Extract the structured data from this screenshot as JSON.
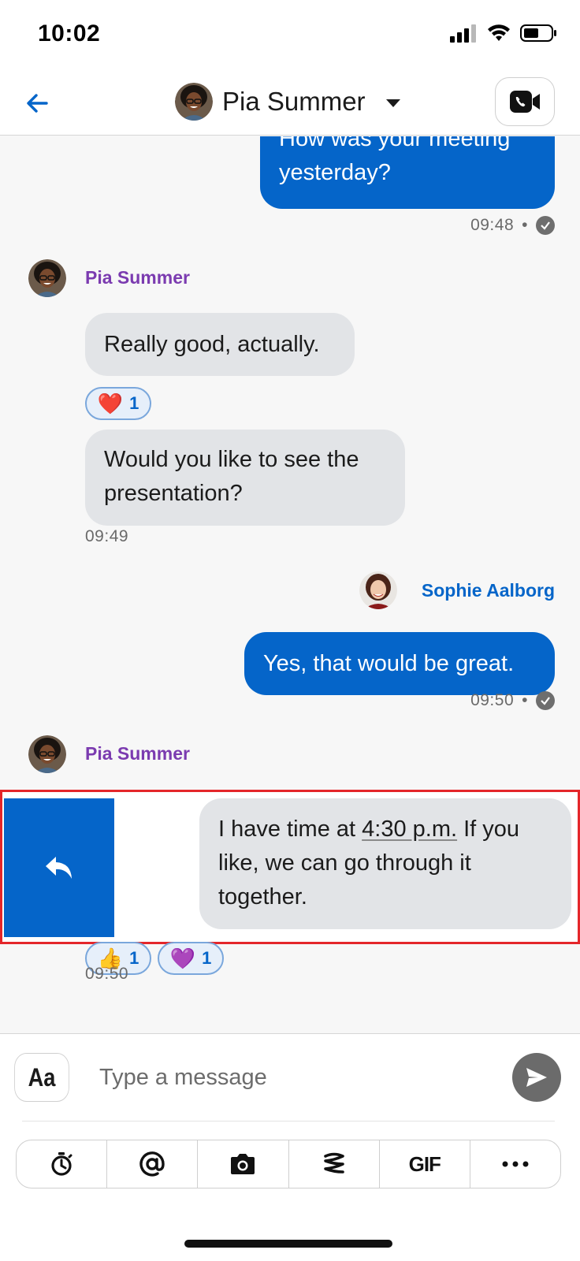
{
  "status_bar": {
    "time": "10:02"
  },
  "header": {
    "contact_name": "Pia Summer"
  },
  "messages": {
    "m1": {
      "text_line1": "How was your meeting",
      "text_line2": "yesterday?",
      "time": "09:48"
    },
    "pia_name_1": "Pia Summer",
    "m2": {
      "text": "Really good, actually."
    },
    "m2_reaction": {
      "emoji": "❤️",
      "count": "1"
    },
    "m3": {
      "text_line1": "Would you like to see the",
      "text_line2": "presentation?",
      "time": "09:49"
    },
    "sophie_name": "Sophie Aalborg",
    "m4": {
      "text": "Yes, that would be great.",
      "time": "09:50"
    },
    "pia_name_2": "Pia Summer",
    "m5": {
      "text_before": "I have time at ",
      "text_time": "4:30 p.m.",
      "text_after": " If you",
      "text_line2": "like, we can go through it",
      "text_line3": "together.",
      "time": "09:50"
    },
    "m5_reactions": [
      {
        "emoji": "👍",
        "count": "1"
      },
      {
        "emoji": "💜",
        "count": "1"
      }
    ]
  },
  "composer": {
    "format_label": "Aa",
    "placeholder": "Type a message",
    "value": "",
    "tools": {
      "gif_label": "GIF"
    }
  },
  "colors": {
    "accent": "#0565c9",
    "pia_name": "#7b3bb0",
    "sophie_name": "#0565c9",
    "incoming_bubble": "#e2e4e7",
    "highlight_border": "#e4262a"
  },
  "icons": [
    "back-arrow-icon",
    "chevron-down-icon",
    "video-call-icon",
    "check-circle-icon",
    "reply-icon",
    "send-icon",
    "timer-icon",
    "at-mention-icon",
    "camera-icon",
    "loop-icon",
    "more-icon"
  ]
}
